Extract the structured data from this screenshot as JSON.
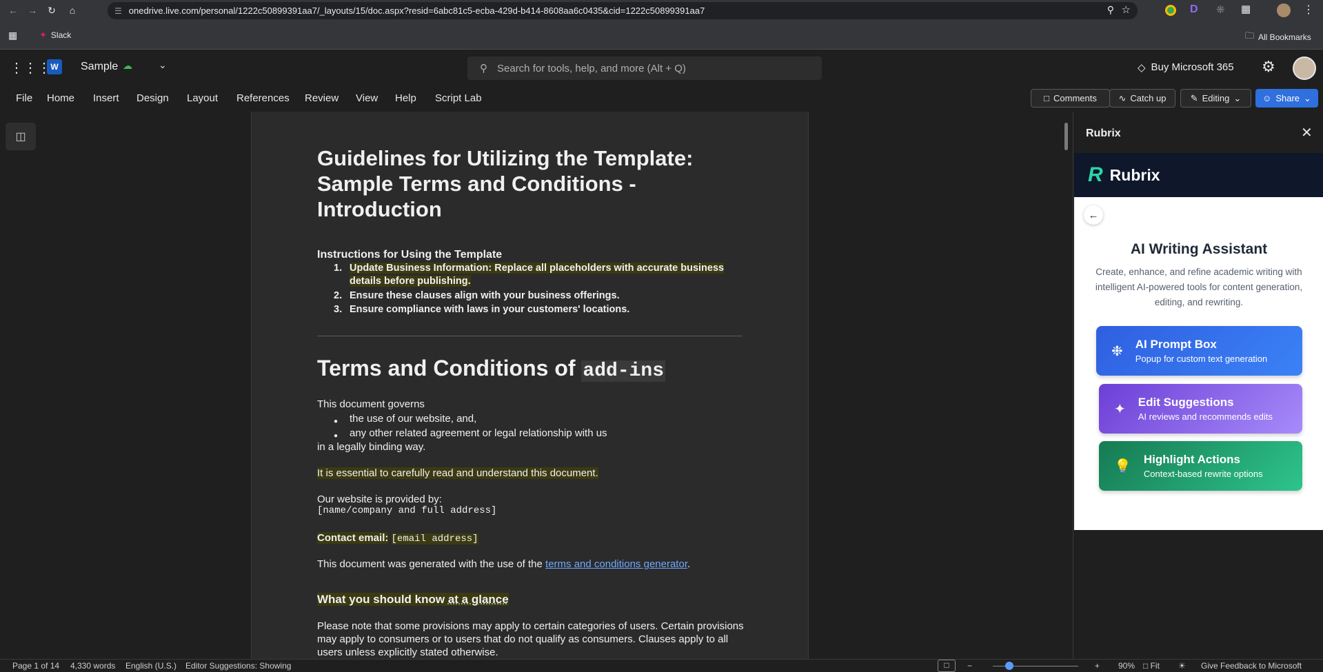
{
  "browser": {
    "url": "onedrive.live.com/personal/1222c50899391aa7/_layouts/15/doc.aspx?resid=6abc81c5-ecba-429d-b414-8608aa6c0435&cid=1222c50899391aa7",
    "bookmark_slack": "Slack",
    "all_bookmarks": "All Bookmarks",
    "ext_d": "D"
  },
  "word": {
    "app_badge": "W",
    "doc_name": "Sample",
    "search_placeholder": "Search for tools, help, and more (Alt + Q)",
    "buy_label": "Buy Microsoft 365"
  },
  "ribbon": {
    "tabs": [
      "File",
      "Home",
      "Insert",
      "Design",
      "Layout",
      "References",
      "Review",
      "View",
      "Help",
      "Script Lab"
    ],
    "comments": "Comments",
    "catch_up": "Catch up",
    "editing": "Editing",
    "share": "Share"
  },
  "document": {
    "title": "Guidelines for Utilizing the Template: Sample Terms and Conditions - Introduction",
    "instructions_heading": "Instructions for Using the Template",
    "instructions": [
      {
        "num": "1.",
        "text": "Update Business Information: Replace all placeholders with accurate business details before publishing."
      },
      {
        "num": "2.",
        "text": "Ensure these clauses align with your business offerings."
      },
      {
        "num": "3.",
        "text": "Ensure compliance with laws in your customers' locations."
      }
    ],
    "terms_heading": "Terms and Conditions of",
    "terms_heading_code": "add-ins",
    "governs": "This document governs",
    "bullets": [
      "the use of our website, and,",
      "any other related agreement or legal relationship with us"
    ],
    "binding": "in a legally binding way.",
    "essential": "It is essential to carefully read and understand this document.",
    "provided_by": "Our website is provided by:",
    "provider_placeholder": "[name/company and full address]",
    "contact_label": "Contact email:",
    "contact_placeholder": "[email address]",
    "generated_prefix": "This document was generated with the use of the",
    "generated_link": "terms and conditions generator",
    "generated_suffix": ".",
    "glance_heading_a": "What you should know ",
    "glance_heading_b": "at a glance",
    "note": "Please note that some provisions may apply to certain categories of users. Certain provisions may apply to consumers or to users that do not qualify as consumers. Clauses apply to all users unless explicitly stated otherwise."
  },
  "panel": {
    "title": "Rubrix",
    "brand": "Rubrix",
    "heading": "AI Writing Assistant",
    "description": "Create, enhance, and refine academic writing with intelligent AI-powered tools for content generation, editing, and rewriting.",
    "cards": [
      {
        "title": "AI Prompt Box",
        "subtitle": "Popup for custom text generation"
      },
      {
        "title": "Edit Suggestions",
        "subtitle": "AI reviews and recommends edits"
      },
      {
        "title": "Highlight Actions",
        "subtitle": "Context-based rewrite options"
      }
    ],
    "colors": {
      "brand_bg": "#0f172a",
      "brand_accent": "#2dd4a7",
      "card1": "#2f5fe0",
      "card2": "#8b5cf6",
      "card3": "#1e9e6e"
    }
  },
  "status": {
    "page": "Page 1 of 14",
    "words": "4,330 words",
    "language": "English (U.S.)",
    "editor": "Editor Suggestions: Showing",
    "zoom": "90%",
    "fit": "Fit",
    "feedback": "Give Feedback to Microsoft"
  }
}
